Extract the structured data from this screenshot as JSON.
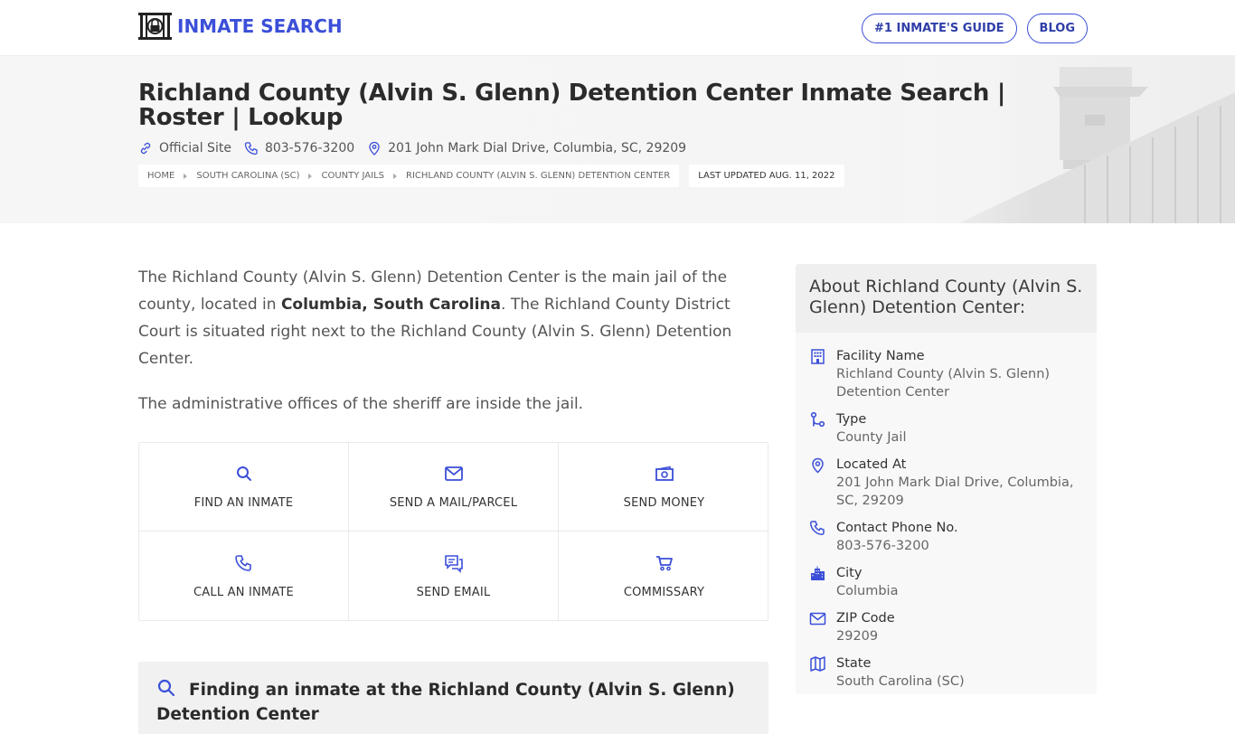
{
  "brand": {
    "name": "INMATE SEARCH",
    "accent": "#3b4fd8"
  },
  "nav": {
    "guide_label": "#1 INMATE'S GUIDE",
    "blog_label": "BLOG"
  },
  "hero": {
    "title": "Richland County (Alvin S. Glenn) Detention Center Inmate Search | Roster | Lookup",
    "official_site": "Official Site",
    "phone": "803-576-3200",
    "address": "201 John Mark Dial Drive, Columbia, SC, 29209",
    "breadcrumbs": [
      "HOME",
      "SOUTH CAROLINA (SC)",
      "COUNTY JAILS",
      "RICHLAND COUNTY (ALVIN S. GLENN) DETENTION CENTER"
    ],
    "last_updated": "LAST UPDATED AUG. 11, 2022"
  },
  "intro": {
    "p1_before": "The Richland County (Alvin S. Glenn) Detention Center is the main jail of the county, located in ",
    "p1_bold": "Columbia, South Carolina",
    "p1_after": ". The Richland County District Court is situated right next to the Richland County (Alvin S. Glenn) Detention Center.",
    "p2": "The administrative offices of the sheriff are inside the jail."
  },
  "actions": [
    {
      "label": "FIND AN INMATE",
      "icon": "search-icon"
    },
    {
      "label": "SEND A MAIL/PARCEL",
      "icon": "mail-icon"
    },
    {
      "label": "SEND MONEY",
      "icon": "money-icon"
    },
    {
      "label": "CALL AN INMATE",
      "icon": "phone-icon"
    },
    {
      "label": "SEND EMAIL",
      "icon": "chat-icon"
    },
    {
      "label": "COMMISSARY",
      "icon": "cart-icon"
    }
  ],
  "finding": {
    "title": "Finding an inmate at the Richland County (Alvin S. Glenn) Detention Center"
  },
  "about": {
    "heading": "About Richland County (Alvin S. Glenn) Detention Center:",
    "items": [
      {
        "label": "Facility Name",
        "value": "Richland County (Alvin S. Glenn) Detention Center",
        "icon": "building-icon"
      },
      {
        "label": "Type",
        "value": "County Jail",
        "icon": "route-icon"
      },
      {
        "label": "Located At",
        "value": "201 John Mark Dial Drive, Columbia, SC, 29209",
        "icon": "map-pin-icon"
      },
      {
        "label": "Contact Phone No.",
        "value": "803-576-3200",
        "icon": "phone-icon"
      },
      {
        "label": "City",
        "value": "Columbia",
        "icon": "city-icon"
      },
      {
        "label": "ZIP Code",
        "value": "29209",
        "icon": "mail-icon"
      },
      {
        "label": "State",
        "value": "South Carolina (SC)",
        "icon": "map-icon"
      }
    ]
  }
}
